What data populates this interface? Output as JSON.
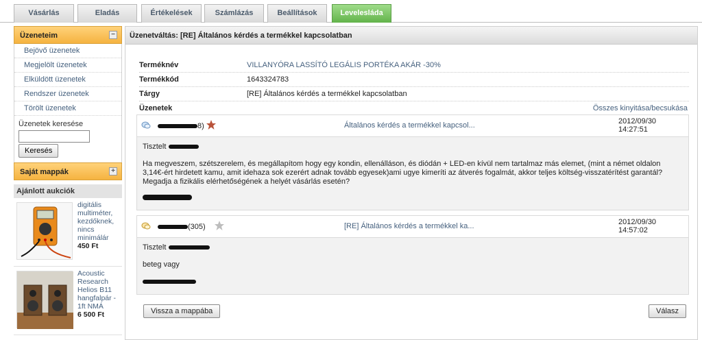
{
  "tabs": [
    {
      "label": "Vásárlás",
      "active": false
    },
    {
      "label": "Eladás",
      "active": false
    },
    {
      "label": "Értékelések",
      "active": false
    },
    {
      "label": "Számlázás",
      "active": false
    },
    {
      "label": "Beállítások",
      "active": false
    },
    {
      "label": "Levelesláda",
      "active": true
    }
  ],
  "sidebar": {
    "messages_title": "Üzeneteim",
    "collapse_symbol": "−",
    "items": [
      {
        "label": "Bejövő üzenetek"
      },
      {
        "label": "Megjelölt üzenetek"
      },
      {
        "label": "Elküldött üzenetek"
      },
      {
        "label": "Rendszer üzenetek"
      },
      {
        "label": "Törölt üzenetek"
      }
    ],
    "search_label": "Üzenetek keresése",
    "search_value": "",
    "search_button": "Keresés",
    "folders_title": "Saját mappák",
    "expand_symbol": "+",
    "recommended_title": "Ajánlott aukciók",
    "recommended": [
      {
        "title": "digitális multiméter, kezdőknek, nincs minimálár",
        "price": "450 Ft"
      },
      {
        "title": "Acoustic Research Helios B11 hangfalpár - 1ft NMÁ",
        "price": "6 500 Ft"
      }
    ]
  },
  "main": {
    "header": "Üzenetváltás: [RE] Általános kérdés a termékkel kapcsolatban",
    "product_name_label": "Terméknév",
    "product_name": "VILLANYÓRA LASSÍTÓ LEGÁLIS PORTÉKA AKÁR -30%",
    "product_code_label": "Termékkód",
    "product_code": "1643324783",
    "subject_label": "Tárgy",
    "subject": "[RE] Általános kérdés a termékkel kapcsolatban",
    "messages_label": "Üzenetek",
    "expand_all": "Összes kinyitása/becsukása",
    "messages": [
      {
        "rating": "8)",
        "subject": "Általános kérdés a termékkel kapcsol...",
        "date": "2012/09/30",
        "time": "14:27:51",
        "greeting": "Tisztelt",
        "body": "Ha megveszem, szétszerelem, és megállapítom hogy egy kondin, ellenálláson, és diódán + LED-en kívül nem tartalmaz más elemet, (mint a német oldalon 3,14€-ért hirdetett kamu, amit idehaza sok ezerért adnak tovább egyesek)ami ugye kimeríti az átverés fogalmát, akkor teljes költség-visszatérítést garantál?\nMegadja a fizikális elérhetőségének a helyét vásárlás esetén?",
        "star_color": "#b9533a"
      },
      {
        "rating": "(305)",
        "subject": "[RE] Általános kérdés a termékkel ka...",
        "date": "2012/09/30",
        "time": "14:57:02",
        "greeting": "Tisztelt",
        "body": "beteg vagy",
        "star_color": "#bdbdbd"
      }
    ],
    "back_button": "Vissza a mappába",
    "reply_button": "Válasz"
  }
}
